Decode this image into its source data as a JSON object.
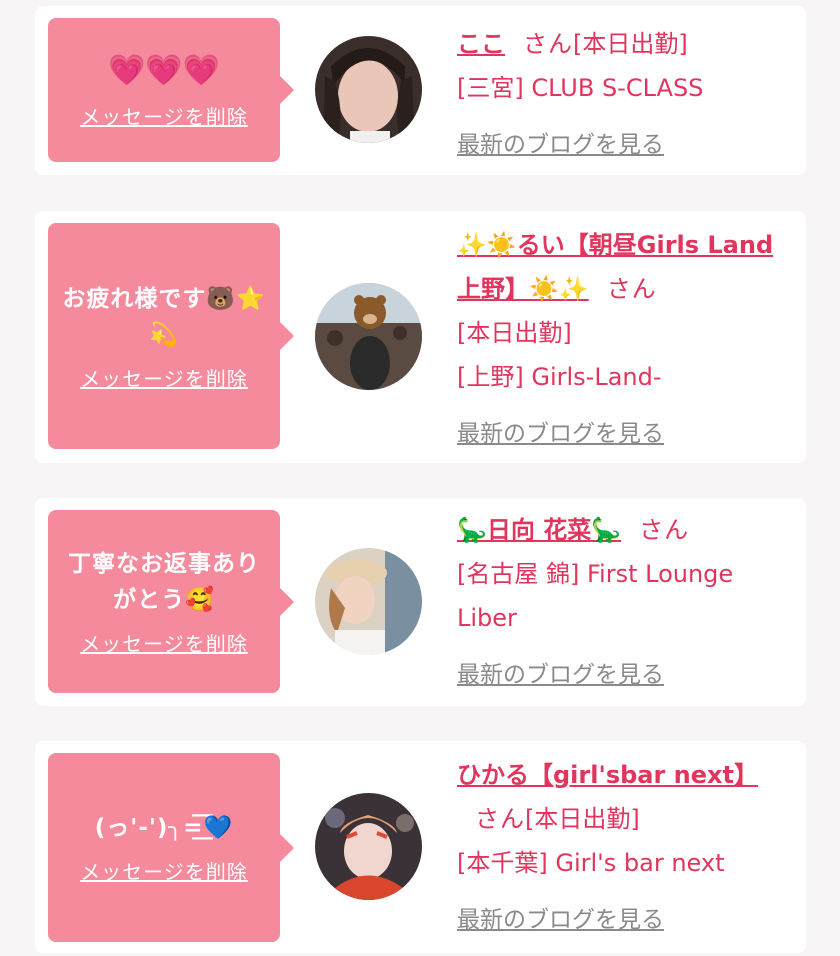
{
  "cards": [
    {
      "message": "💗💗💗",
      "delete_label": "メッセージを削除",
      "name": "ここ",
      "san": "さん",
      "status": "[本日出勤]",
      "shop": "[三宮] CLUB S-CLASS",
      "blog_label": "最新のブログを見る"
    },
    {
      "message": "お疲れ様です🐻⭐💫",
      "delete_label": "メッセージを削除",
      "name": "✨☀️るい【朝昼Girls Land上野】☀️✨",
      "san": "さん",
      "status": "[本日出勤]",
      "shop": "[上野] Girls-Land-",
      "blog_label": "最新のブログを見る"
    },
    {
      "message": "丁寧なお返事ありがとう🥰",
      "delete_label": "メッセージを削除",
      "name": "🦕日向 花菜🦕",
      "san": "さん",
      "status": "",
      "shop": "[名古屋 錦] First Lounge Liber",
      "blog_label": "最新のブログを見る"
    },
    {
      "message": "(っ'-')╮=͟͟͞͞💙",
      "delete_label": "メッセージを削除",
      "name": "ひかる【girl'sbar next】",
      "san": "さん",
      "status": "[本日出勤]",
      "shop": "[本千葉] Girl's bar next",
      "blog_label": "最新のブログを見る"
    }
  ],
  "colors": {
    "bubble": "#f58a9c",
    "accent": "#e0355d",
    "blog_link": "#8a8a8a",
    "page_bg": "#f7f5f6"
  }
}
